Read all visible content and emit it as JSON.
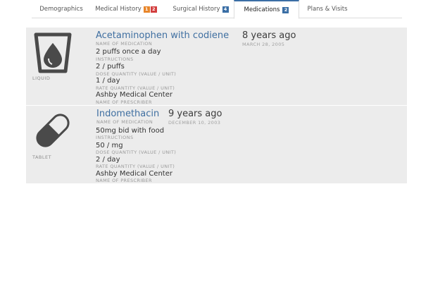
{
  "tabs": [
    {
      "label": "Demographics",
      "badges": []
    },
    {
      "label": "Medical History",
      "badges": [
        {
          "text": "1",
          "color": "#e8852a"
        },
        {
          "text": "2",
          "color": "#d33f3f"
        }
      ]
    },
    {
      "label": "Surgical History",
      "badges": [
        {
          "text": "4",
          "color": "#3a6ea5"
        }
      ]
    },
    {
      "label": "Medications",
      "badges": [
        {
          "text": "2",
          "color": "#3a6ea5"
        }
      ],
      "active": true
    },
    {
      "label": "Plans & Visits",
      "badges": []
    }
  ],
  "medications": [
    {
      "name": "Acetaminophen with codiene",
      "name_label": "NAME OF MEDICATION",
      "ago": "8 years ago",
      "date": "MARCH 28, 2005",
      "form": "LIQUID",
      "icon": "liquid-glass-icon",
      "instructions": "2 puffs once a day",
      "instructions_label": "INSTRUCTIONS",
      "dose": "2 / puffs",
      "dose_label": "DOSE QUANTITY (VALUE / UNIT)",
      "rate": "1 / day",
      "rate_label": "RATE QUANTITY (VALUE / UNIT)",
      "prescriber": "Ashby Medical Center",
      "prescriber_label": "NAME OF PRESCRIBER"
    },
    {
      "name": "Indomethacin",
      "name_label": "NAME OF MEDICATION",
      "ago": "9 years ago",
      "date": "DECEMBER 10, 2003",
      "form": "TABLET",
      "icon": "tablet-capsule-icon",
      "instructions": "50mg bid with food",
      "instructions_label": "INSTRUCTIONS",
      "dose": "50 / mg",
      "dose_label": "DOSE QUANTITY (VALUE / UNIT)",
      "rate": "2 / day",
      "rate_label": "RATE QUANTITY (VALUE / UNIT)",
      "prescriber": "Ashby Medical Center",
      "prescriber_label": "NAME OF PRESCRIBER"
    }
  ]
}
